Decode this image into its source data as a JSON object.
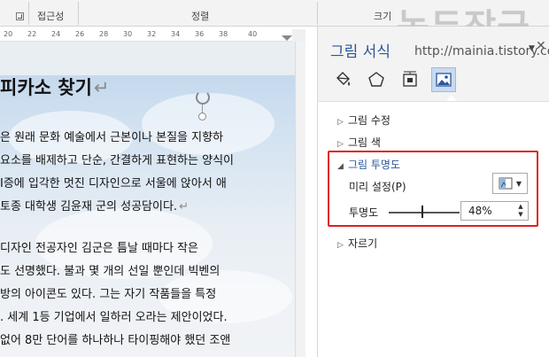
{
  "ribbon": {
    "groups": [
      {
        "label": "접근성"
      },
      {
        "label": "정렬"
      },
      {
        "label": "크기"
      }
    ]
  },
  "watermark": {
    "text": "녹두장군",
    "url": "http://mainia.tistory.com"
  },
  "ruler": {
    "numbers": [
      "20",
      "22",
      "24",
      "26",
      "28",
      "30",
      "32",
      "34",
      "36",
      "38",
      "40"
    ]
  },
  "document": {
    "title": "피카소 찾기",
    "pilcrow": "↵",
    "paragraph1": [
      "은 원래 문화 예술에서 근본이나 본질을 지향하",
      "요소를 배제하고 단순, 간결하게 표현하는 양식이",
      "I증에 입각한 멋진 디자인으로 서울에 앉아서 애",
      "토종 대학생 김윤재 군의 성공담이다."
    ],
    "paragraph2": [
      " 디자인 전공자인 김군은 틈날 때마다 작은",
      "도 선명했다. 불과 몇 개의 선일 뿐인데 빅벤의",
      "방의 아이콘도 있다. 그는 자기 작품들을 특정",
      ". 세계 1등 기업에서 일하러 오라는 제안이었다.",
      "없어 8만 단어를 하나하나 타이핑해야 했던 조앤"
    ]
  },
  "pane": {
    "title": "그림 서식",
    "tab_icons": [
      "fill-bucket-icon",
      "pentagon-effects-icon",
      "layout-size-icon",
      "picture-icon"
    ],
    "sections": [
      {
        "label": "그림 수정",
        "expanded": false
      },
      {
        "label": "그림 색",
        "expanded": false
      },
      {
        "label": "그림 투명도",
        "expanded": true
      },
      {
        "label": "자르기",
        "expanded": false
      }
    ],
    "transparency": {
      "preset_label": "미리 설정(P)",
      "transparency_label": "투명도",
      "value": "48%",
      "level": 0.48
    }
  },
  "colors": {
    "accent": "#2b579a",
    "highlight_box": "#e01f1f",
    "active_tab": "#c9daf0"
  }
}
